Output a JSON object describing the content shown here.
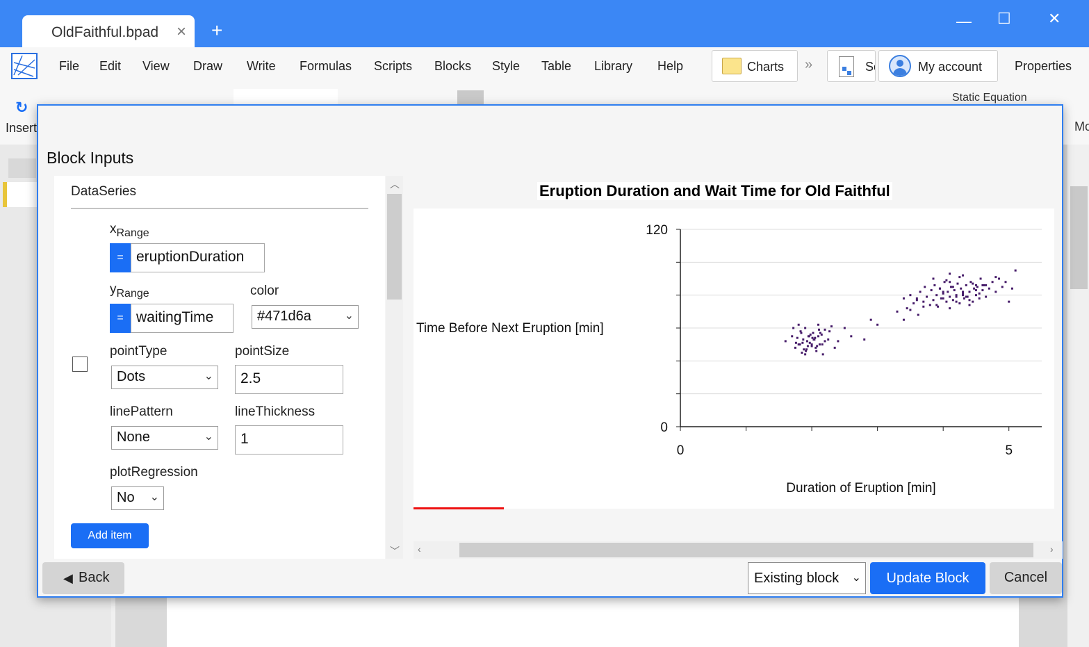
{
  "window": {
    "tab_title": "OldFaithful.bpad",
    "tab_close": "×",
    "new_tab": "+",
    "minimize": "—",
    "maximize": "☐",
    "close": "✕"
  },
  "menu": {
    "items": [
      "File",
      "Edit",
      "View",
      "Draw",
      "Write",
      "Formulas",
      "Scripts",
      "Blocks",
      "Style",
      "Table",
      "Library",
      "Help"
    ],
    "charts_label": "Charts",
    "next_label": "Sc",
    "account_label": "My account",
    "properties_label": "Properties",
    "insert_label": "Insert",
    "static_equation_label": "Static Equation",
    "right_cut_label": "Mo"
  },
  "dialog": {
    "title": "Block Inputs",
    "section": "DataSeries",
    "x_label": "x",
    "x_sub": "Range",
    "x_value": "eruptionDuration",
    "y_label": "y",
    "y_sub": "Range",
    "y_value": "waitingTime",
    "eq_symbol": "=",
    "color_label": "color",
    "color_value": "#471d6a",
    "point_type_label": "pointType",
    "point_type_value": "Dots",
    "point_size_label": "pointSize",
    "point_size_value": "2.5",
    "line_pattern_label": "linePattern",
    "line_pattern_value": "None",
    "line_thickness_label": "lineThickness",
    "line_thickness_value": "1",
    "plot_regression_label": "plotRegression",
    "plot_regression_value": "No",
    "add_item_label": "Add item",
    "back_label": "Back",
    "existing_label": "Existing block",
    "update_label": "Update Block",
    "cancel_label": "Cancel"
  },
  "chart_data": {
    "type": "scatter",
    "title": "Eruption Duration and Wait Time for Old Faithful",
    "xlabel": "Duration of Eruption [min]",
    "ylabel": "Time Before Next Eruption [min]",
    "xlim": [
      0,
      5.5
    ],
    "ylim": [
      0,
      120
    ],
    "xticks": [
      "0",
      "5"
    ],
    "yticks": [
      "120",
      "0"
    ],
    "point_color": "#471d6a",
    "grid": true,
    "series": [
      {
        "x": [
          1.6,
          1.7,
          1.75,
          1.8,
          1.83,
          1.85,
          1.87,
          1.9,
          1.92,
          1.95,
          1.97,
          2.0,
          2.02,
          2.05,
          2.07,
          2.1,
          2.12,
          2.15,
          2.17,
          2.2,
          2.25,
          2.3,
          2.35,
          2.4,
          1.78,
          1.82,
          1.88,
          1.93,
          1.98,
          2.03,
          2.08,
          2.13,
          1.72,
          1.86,
          1.96,
          2.06,
          2.16,
          2.27,
          1.91,
          2.01,
          2.11,
          1.8,
          1.9,
          2.0,
          2.1,
          2.2,
          1.84,
          1.94,
          2.04,
          1.76,
          2.5,
          2.6,
          2.8,
          2.9,
          3.0,
          3.3,
          3.4,
          3.45,
          3.5,
          3.55,
          3.6,
          3.62,
          3.65,
          3.7,
          3.72,
          3.75,
          3.8,
          3.82,
          3.85,
          3.87,
          3.9,
          3.92,
          3.95,
          3.97,
          4.0,
          4.02,
          4.05,
          4.07,
          4.1,
          4.12,
          4.15,
          4.17,
          4.2,
          4.22,
          4.25,
          4.27,
          4.3,
          4.32,
          4.35,
          4.37,
          4.4,
          4.42,
          4.45,
          4.47,
          4.5,
          4.52,
          4.55,
          4.57,
          4.6,
          4.62,
          4.65,
          4.7,
          4.75,
          4.8,
          4.85,
          4.9,
          5.0,
          5.1,
          3.9,
          4.0,
          4.1,
          4.2,
          4.3,
          4.4,
          4.5,
          4.6,
          4.0,
          4.2,
          4.4,
          4.1,
          4.3,
          3.95,
          4.05,
          4.25,
          4.45,
          4.55,
          3.85,
          4.15,
          4.35,
          3.5,
          3.6,
          3.7,
          4.65,
          4.8,
          4.95,
          5.05,
          3.4,
          4.1,
          4.3,
          4.5
        ],
        "y": [
          52,
          55,
          48,
          50,
          58,
          45,
          53,
          60,
          47,
          55,
          51,
          49,
          57,
          54,
          46,
          62,
          50,
          56,
          44,
          59,
          53,
          61,
          48,
          52,
          54,
          50,
          47,
          52,
          56,
          53,
          49,
          57,
          60,
          51,
          55,
          48,
          50,
          58,
          46,
          54,
          59,
          62,
          44,
          50,
          55,
          52,
          57,
          49,
          53,
          51,
          60,
          55,
          53,
          65,
          62,
          70,
          65,
          72,
          80,
          75,
          78,
          68,
          82,
          76,
          85,
          79,
          74,
          83,
          77,
          86,
          80,
          73,
          84,
          78,
          81,
          88,
          76,
          82,
          79,
          85,
          77,
          83,
          80,
          87,
          75,
          84,
          81,
          78,
          86,
          79,
          82,
          88,
          76,
          84,
          80,
          85,
          78,
          90,
          83,
          86,
          79,
          84,
          88,
          82,
          90,
          85,
          76,
          95,
          74,
          78,
          72,
          76,
          80,
          74,
          83,
          86,
          82,
          79,
          77,
          88,
          92,
          84,
          89,
          91,
          87,
          81,
          90,
          85,
          79,
          71,
          77,
          73,
          86,
          91,
          88,
          84,
          78,
          93,
          82,
          86
        ]
      }
    ]
  }
}
